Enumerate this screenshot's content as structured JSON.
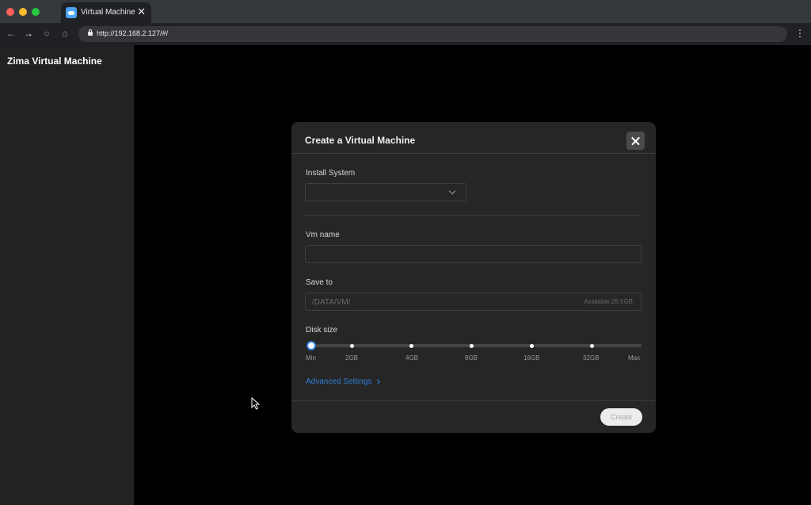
{
  "browser": {
    "tab_title": "Virtual Machine",
    "url": "http://192.168.2.127/#/"
  },
  "app": {
    "title": "Zima Virtual Machine"
  },
  "modal": {
    "title": "Create a Virtual Machine",
    "install_system_label": "Install System",
    "install_system_value": "",
    "vm_name_label": "Vm name",
    "vm_name_value": "",
    "save_to_label": "Save to",
    "save_to_path": "/DATA/VM/",
    "save_to_available": "Available:28.5GB",
    "disk_size_label": "Disk size",
    "disk_size_ticks": [
      "Min",
      "2GB",
      "4GB",
      "8GB",
      "16GB",
      "32GB",
      "Max"
    ],
    "disk_size_selected": "Min",
    "advanced_settings_label": "Advanced Settings",
    "create_label": "Create"
  },
  "colors": {
    "accent": "#2f7fd9",
    "sidebar_bg": "#222222",
    "modal_bg": "#262626",
    "main_bg": "#000000"
  }
}
